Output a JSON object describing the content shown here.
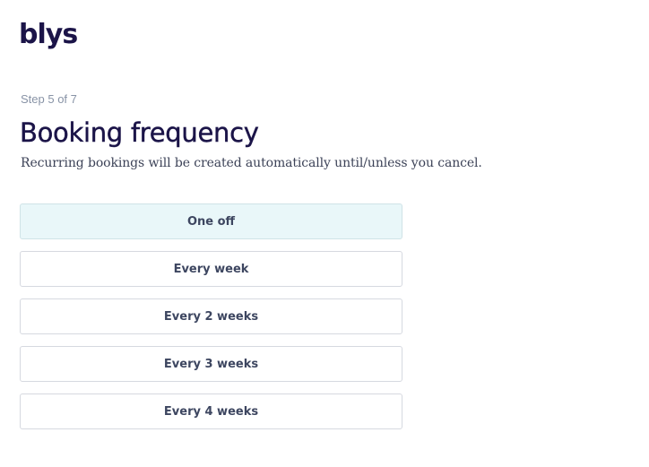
{
  "brand": {
    "logo_text": "blys"
  },
  "header": {
    "step_text": "Step 5 of 7",
    "title": "Booking frequency",
    "subtitle": "Recurring bookings will be created automatically until/unless you cancel."
  },
  "frequency": {
    "selected": "One off",
    "options": [
      {
        "label": "One off"
      },
      {
        "label": "Every week"
      },
      {
        "label": "Every 2 weeks"
      },
      {
        "label": "Every 3 weeks"
      },
      {
        "label": "Every 4 weeks"
      }
    ]
  },
  "colors": {
    "brand_navy": "#1b1448",
    "selected_background": "#e9f7f9",
    "option_border": "#d6d9e0",
    "muted_text": "#8893a6"
  }
}
